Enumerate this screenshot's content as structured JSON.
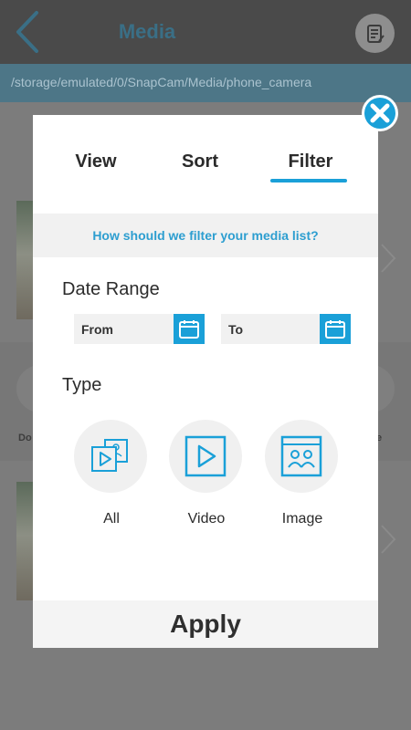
{
  "topbar": {
    "title": "Media",
    "back_icon": "chevron-left-icon",
    "notes_icon": "notes-icon"
  },
  "path": "/storage/emulated/0/SnapCam/Media/phone_camera",
  "background": {
    "left_label": "Do",
    "right_label": "e"
  },
  "modal": {
    "tabs": [
      {
        "label": "View",
        "active": false
      },
      {
        "label": "Sort",
        "active": false
      },
      {
        "label": "Filter",
        "active": true
      }
    ],
    "question": "How should we filter your media list?",
    "date_range": {
      "title": "Date Range",
      "from_placeholder": "From",
      "to_placeholder": "To",
      "calendar_icon": "calendar-icon"
    },
    "type": {
      "title": "Type",
      "options": [
        {
          "label": "All",
          "icon": "all-media-icon"
        },
        {
          "label": "Video",
          "icon": "video-icon"
        },
        {
          "label": "Image",
          "icon": "image-icon"
        }
      ]
    },
    "apply_label": "Apply",
    "close_icon": "close-icon"
  },
  "colors": {
    "accent": "#1aa0d8",
    "topbar": "#4a4a4a",
    "pathbar": "#4d7687",
    "overlay": "#7c7c7c"
  }
}
